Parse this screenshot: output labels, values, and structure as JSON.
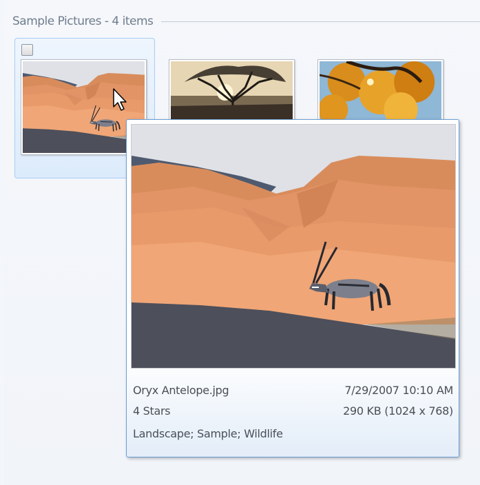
{
  "group": {
    "title": "Sample Pictures - 4 items"
  },
  "items": [
    {
      "name": "Oryx Antelope.jpg",
      "selected": true
    },
    {
      "name": "tree-thumbnail"
    },
    {
      "name": "autumn-leaves-thumbnail"
    }
  ],
  "tooltip": {
    "filename": "Oryx Antelope.jpg",
    "date": "7/29/2007 10:10 AM",
    "rating": "4 Stars",
    "size": "290 KB (1024 x 768)",
    "tags": "Landscape; Sample; Wildlife"
  },
  "colors": {
    "selection_border": "#a9cdf3",
    "selection_fill": "#dcebfb",
    "tooltip_border": "#6a9ed4",
    "header_text": "#6f7d8c"
  },
  "icons": {
    "cursor": "arrow-cursor-icon",
    "checkbox": "checkbox-icon"
  }
}
